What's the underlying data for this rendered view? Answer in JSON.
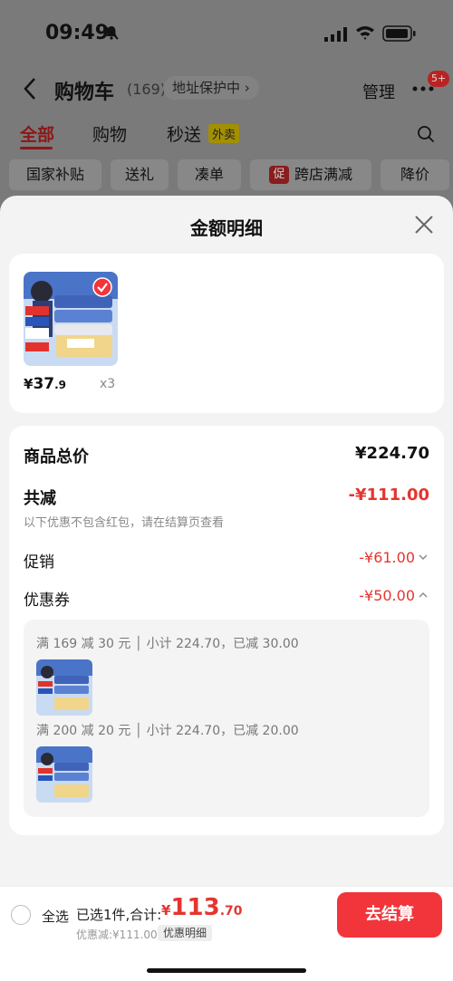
{
  "status": {
    "time": "09:49"
  },
  "nav": {
    "title": "购物车",
    "count": "(169)",
    "address": "地址保护中 ›",
    "manage": "管理",
    "badge": "5+"
  },
  "tabs": [
    {
      "label": "全部"
    },
    {
      "label": "购物"
    },
    {
      "label": "秒送"
    }
  ],
  "tab_tag": "外卖",
  "chips": [
    {
      "label": "国家补贴"
    },
    {
      "label": "送礼"
    },
    {
      "label": "凑单"
    },
    {
      "label": "跨店满减",
      "tag": "促"
    },
    {
      "label": "降价"
    }
  ],
  "sheet": {
    "title": "金额明细"
  },
  "product": {
    "price_symbol": "¥",
    "price_int": "37",
    "price_dec": ".9",
    "qty": "x3"
  },
  "summary": {
    "goods_total_label": "商品总价",
    "goods_total_value": "¥224.70",
    "reduce_label": "共减",
    "reduce_value": "-¥111.00",
    "hint": "以下优惠不包含红包，请在结算页查看",
    "promo_label": "促销",
    "promo_value": "-¥61.00",
    "coupon_label": "优惠券",
    "coupon_value": "-¥50.00"
  },
  "coupons": [
    {
      "text": "满 169 减 30 元 │ 小计 224.70，已减 30.00"
    },
    {
      "text": "满 200 减 20 元 │ 小计 224.70，已减 20.00"
    }
  ],
  "bottom": {
    "select_all": "全选",
    "selected": "已选1件,合计:",
    "total_symbol": "¥",
    "total_int": "113",
    "total_dec": ".70",
    "discount": "优惠减:¥111.00",
    "detail": "优惠明细",
    "checkout": "去结算"
  },
  "colors": {
    "accent_red": "#e43530",
    "checkout_red": "#f2343b",
    "sheet_bg": "#f3f3f3"
  }
}
